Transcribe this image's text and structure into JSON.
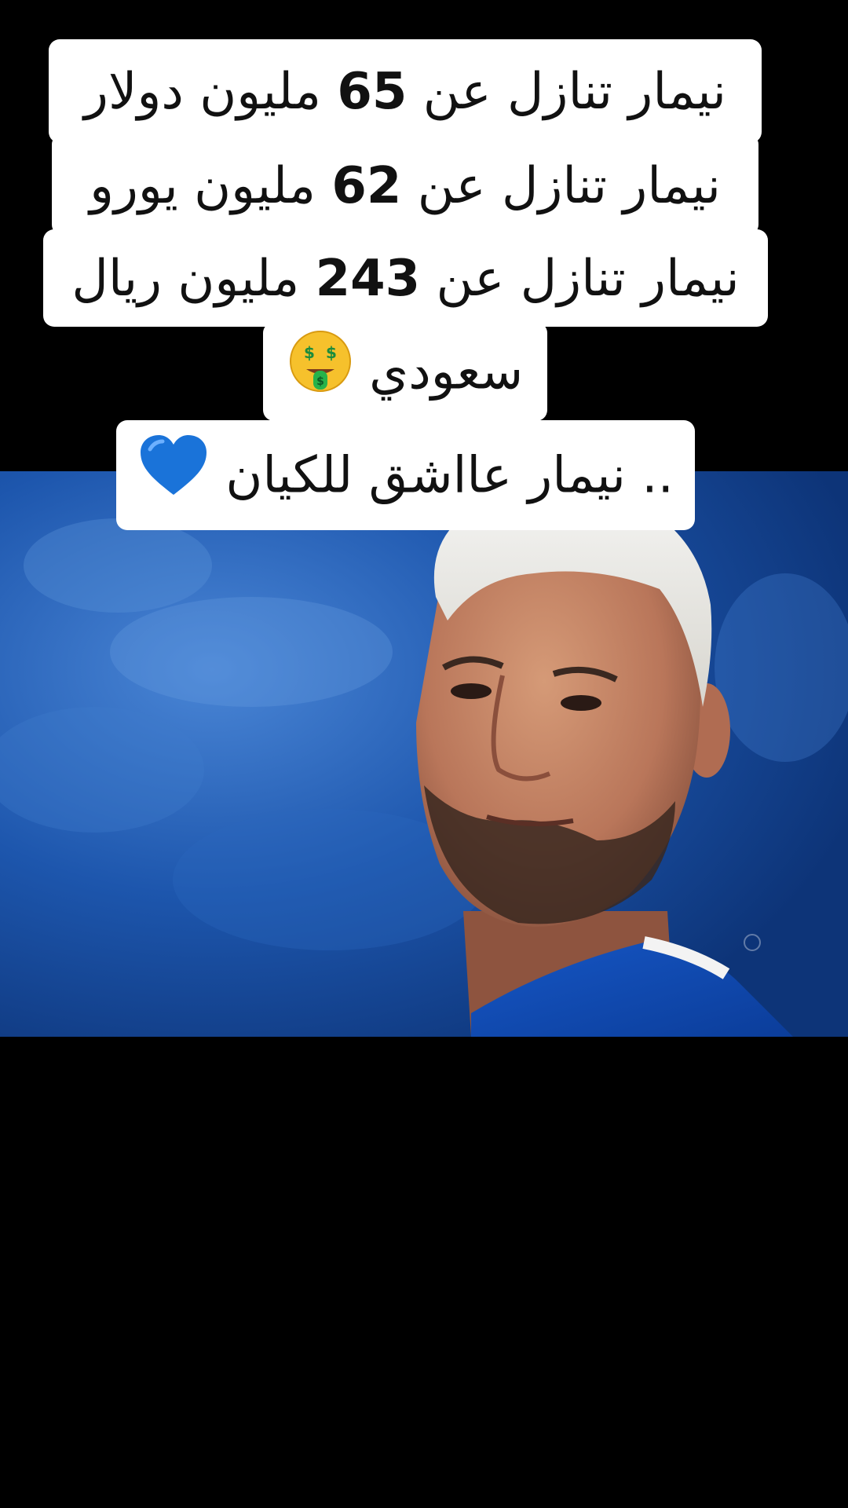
{
  "caption": {
    "line1": {
      "before": "نيمار تنازل عن",
      "num": "65",
      "after": "مليون دولار"
    },
    "line2": {
      "before": "نيمار تنازل عن",
      "num": "62",
      "after": "مليون يورو"
    },
    "line3": {
      "before": "نيمار تنازل عن",
      "num": "243",
      "after": "مليون ريال"
    },
    "line4": {
      "text": "سعودي"
    },
    "line5": {
      "text": ".. نيمار عااشق للكيان"
    }
  },
  "icons": {
    "money_face": "money-mouth-face-icon",
    "blue_heart": "blue-heart-icon"
  },
  "colors": {
    "caption_bg": "#ffffff",
    "caption_text": "#111111",
    "heart": "#1a73d9",
    "background": "#000000"
  }
}
